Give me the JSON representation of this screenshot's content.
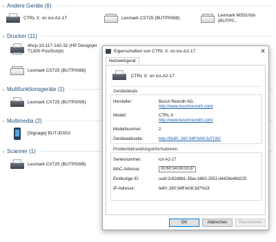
{
  "groups": [
    {
      "title": "Andere Geräte (6)"
    },
    {
      "title": "Drucker (11)"
    },
    {
      "title": "Multifunktionsgeräte (1)"
    },
    {
      "title": "Multimedia (2)"
    },
    {
      "title": "Scanner (1)"
    }
  ],
  "devices": {
    "other": [
      {
        "label": "CTRL X: on icx-A2-17"
      },
      {
        "label": "Lexmark CS725 (BUTP0088)"
      },
      {
        "label": "Lexmark MS510dn (BUTP0..."
      }
    ],
    "printers": [
      {
        "label": "dhcp-10-117-142-32 (HP Designjet\nT1300 PostScript)"
      },
      {
        "label": "Lexmark CS725 (BUTP0088)"
      }
    ],
    "mfp": [
      {
        "label": "Lexmark CX725 (BUTP0099)"
      }
    ],
    "multimedia": [
      {
        "label": "[Signage] BUT-IDS02"
      }
    ],
    "scanner": [
      {
        "label": "Lexmark CX725 (BUTP0099)"
      }
    ]
  },
  "dialog": {
    "title": "Eigenschaften von CTRL X: on icx-A2-17",
    "close_glyph": "✕",
    "tab": "Netzwerkgerät",
    "device_name": "CTRL X: on icx-A2-17",
    "details_label": "Gerätedetails",
    "manufacturer_label": "Hersteller:",
    "manufacturer": "Bosch Rexroth AG,",
    "manufacturer_link": "http://www.boschrexroth.com/",
    "model_label": "Modell:",
    "model": "CTRL X",
    "model_link": "http://www.boschrexroth.com/",
    "model_number_label": "Modellnummer:",
    "model_number": "2",
    "website_label": "Gerätewebseite:",
    "website_link": "http://[fe80::260:34ff:fe08:3d7]:80/",
    "troubleshoot_label": "Problembehandlungsinformationen",
    "serial_label": "Seriennummer:",
    "serial": "icx-A2-17",
    "mac_label": "MAC-Adresse:",
    "mac": "00:60:34:08:03:d7",
    "uid_label": "Eindeutige ID:",
    "uid": "uuid:2c62d8b1-35ac-b662-2551-d4428e48d225",
    "ip_label": "IP-Adresse:",
    "ip": "fe80::260:34ff:fe08:3d7%19",
    "ok": "OK",
    "cancel": "Abbrechen",
    "apply": "Übernehmen"
  }
}
